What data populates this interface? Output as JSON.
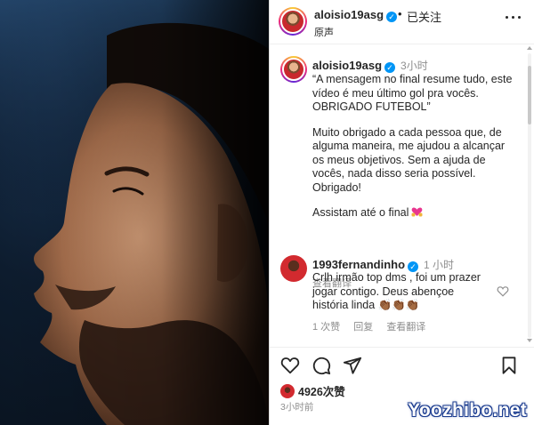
{
  "header": {
    "username": "aloisio19asg",
    "verified_mark": "✓",
    "separator": "•",
    "follow_status": "已关注",
    "subtitle": "原声",
    "more_icon": "more-horizontal-icon"
  },
  "caption": {
    "username": "aloisio19asg",
    "verified_mark": "✓",
    "time": "3小时",
    "paragraphs": [
      "“A mensagem no final resume tudo, este vídeo é meu último gol pra vocês. OBRIGADO FUTEBOL”",
      "Muito obrigado a cada pessoa que, de alguma maneira, me ajudou a alcançar os meus objetivos. Sem a ajuda de vocês, nada disso seria possível. Obrigado!",
      "Assistam até o final"
    ],
    "translate": "查看翻译"
  },
  "comment": {
    "username": "1993fernandinho",
    "verified_mark": "✓",
    "time": "1 小时",
    "text": "Crlh irmão top dms , foi um prazer jogar contigo. Deus abençoe história linda",
    "emojis": "👏🏾👏🏾👏🏾",
    "likes": "1 次赞",
    "reply": "回复",
    "translate": "查看翻译"
  },
  "actions": {
    "like_icon": "heart-icon",
    "comment_icon": "comment-icon",
    "share_icon": "share-icon",
    "save_icon": "bookmark-icon"
  },
  "likes": {
    "count": "4926次赞"
  },
  "post_time": "3小时前",
  "watermark": "Yoozhibo.net",
  "colors": {
    "accent": "#0095f6",
    "text": "#262626",
    "muted": "#8e8e8e"
  }
}
